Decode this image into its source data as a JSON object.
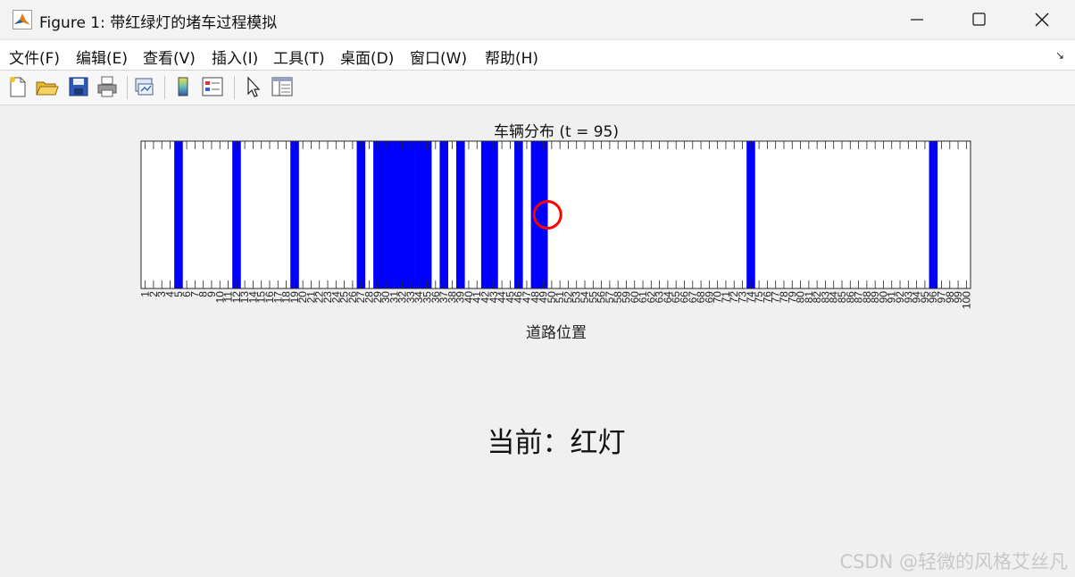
{
  "window": {
    "title": "Figure 1: 带红绿灯的堵车过程模拟",
    "controls": {
      "minimize": "minimize",
      "maximize": "maximize",
      "close": "close"
    }
  },
  "menu": {
    "items": [
      {
        "label": "文件(F)"
      },
      {
        "label": "编辑(E)"
      },
      {
        "label": "查看(V)"
      },
      {
        "label": "插入(I)"
      },
      {
        "label": "工具(T)"
      },
      {
        "label": "桌面(D)"
      },
      {
        "label": "窗口(W)"
      },
      {
        "label": "帮助(H)"
      }
    ]
  },
  "toolbar": {
    "buttons": [
      {
        "icon": "new-figure-icon"
      },
      {
        "icon": "open-file-icon"
      },
      {
        "icon": "save-icon"
      },
      {
        "icon": "print-icon"
      },
      {
        "icon": "link-plot-icon"
      },
      {
        "icon": "colorbar-icon"
      },
      {
        "icon": "legend-icon"
      },
      {
        "icon": "pointer-icon"
      },
      {
        "icon": "property-editor-icon"
      }
    ]
  },
  "chart_data": {
    "type": "heatmap",
    "title": "车辆分布 (t = 95)",
    "xlabel": "道路位置",
    "ylabel": "",
    "xlim": [
      1,
      100
    ],
    "tick_labels": [
      "1",
      "2",
      "3",
      "4",
      "5",
      "6",
      "7",
      "8",
      "9",
      "10",
      "11",
      "12",
      "13",
      "14",
      "15",
      "16",
      "17",
      "18",
      "19",
      "20",
      "21",
      "22",
      "23",
      "24",
      "25",
      "26",
      "27",
      "28",
      "29",
      "30",
      "31",
      "32",
      "33",
      "34",
      "35",
      "36",
      "37",
      "38",
      "39",
      "40",
      "41",
      "42",
      "43",
      "44",
      "45",
      "46",
      "47",
      "48",
      "49",
      "50",
      "51",
      "52",
      "53",
      "54",
      "55",
      "56",
      "57",
      "58",
      "59",
      "60",
      "61",
      "62",
      "63",
      "64",
      "65",
      "66",
      "67",
      "68",
      "69",
      "70",
      "71",
      "72",
      "73",
      "74",
      "75",
      "76",
      "77",
      "78",
      "79",
      "80",
      "81",
      "82",
      "83",
      "84",
      "85",
      "86",
      "87",
      "88",
      "89",
      "90",
      "91",
      "92",
      "93",
      "94",
      "95",
      "96",
      "97",
      "98",
      "99",
      "100"
    ],
    "occupied_positions": [
      5,
      12,
      19,
      27,
      29,
      30,
      31,
      32,
      33,
      34,
      35,
      37,
      39,
      42,
      43,
      46,
      48,
      49,
      74,
      96
    ],
    "traffic_light_position": 50,
    "traffic_light_state": "red",
    "colors": {
      "vehicle": "#0000ff",
      "empty": "#ffffff",
      "light_marker": "#ff0000"
    }
  },
  "status": {
    "text": "当前：红灯"
  },
  "watermark": "CSDN @轻微的风格艾丝凡"
}
